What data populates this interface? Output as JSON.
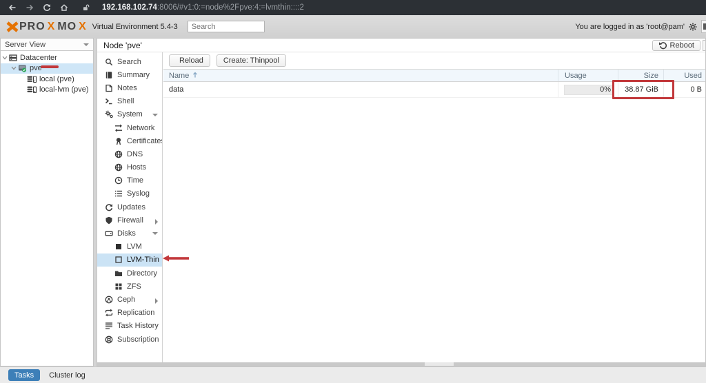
{
  "browser": {
    "url_host": "192.168.102.74",
    "url_path": ":8006/#v1:0:=node%2Fpve:4:=lvmthin::::2",
    "icons": [
      "back-icon",
      "forward-icon",
      "reload-icon",
      "home-icon",
      "lock-icon"
    ]
  },
  "header": {
    "brand": "PROXMOX",
    "brand_orange_letters": [
      3,
      6
    ],
    "subtitle": "Virtual Environment 5.4-3",
    "search_placeholder": "Search",
    "login_text": "You are logged in as 'root@pam'",
    "gear_icon": "gear-icon",
    "accent_orange": "#e57200"
  },
  "sidebar": {
    "view_label": "Server View",
    "tree": [
      {
        "label": "Datacenter",
        "icon": "datacenter-icon",
        "depth": 0,
        "expanded": true,
        "selected": false
      },
      {
        "label": "pve",
        "icon": "node-icon",
        "depth": 1,
        "expanded": true,
        "selected": true
      },
      {
        "label": "local (pve)",
        "icon": "storage-icon",
        "depth": 2,
        "expanded": null,
        "selected": false
      },
      {
        "label": "local-lvm (pve)",
        "icon": "storage-icon",
        "depth": 2,
        "expanded": null,
        "selected": false
      }
    ]
  },
  "node_panel": {
    "title": "Node 'pve'",
    "reboot_label": "Reboot",
    "reboot_icon": "reboot-icon",
    "menu": [
      {
        "label": "Search",
        "icon": "search-icon",
        "child": false,
        "state": null,
        "selected": false
      },
      {
        "label": "Summary",
        "icon": "book-icon",
        "child": false,
        "state": null,
        "selected": false
      },
      {
        "label": "Notes",
        "icon": "note-icon",
        "child": false,
        "state": null,
        "selected": false
      },
      {
        "label": "Shell",
        "icon": "terminal-icon",
        "child": false,
        "state": null,
        "selected": false
      },
      {
        "label": "System",
        "icon": "cogs-icon",
        "child": false,
        "state": "expanded",
        "selected": false
      },
      {
        "label": "Network",
        "icon": "network-icon",
        "child": true,
        "state": null,
        "selected": false
      },
      {
        "label": "Certificates",
        "icon": "certificate-icon",
        "child": true,
        "state": null,
        "selected": false
      },
      {
        "label": "DNS",
        "icon": "globe-icon",
        "child": true,
        "state": null,
        "selected": false
      },
      {
        "label": "Hosts",
        "icon": "globe-icon",
        "child": true,
        "state": null,
        "selected": false
      },
      {
        "label": "Time",
        "icon": "clock-icon",
        "child": true,
        "state": null,
        "selected": false
      },
      {
        "label": "Syslog",
        "icon": "list-icon",
        "child": true,
        "state": null,
        "selected": false
      },
      {
        "label": "Updates",
        "icon": "refresh-icon",
        "child": false,
        "state": null,
        "selected": false
      },
      {
        "label": "Firewall",
        "icon": "shield-icon",
        "child": false,
        "state": "collapsed",
        "selected": false
      },
      {
        "label": "Disks",
        "icon": "disk-icon",
        "child": false,
        "state": "expanded",
        "selected": false
      },
      {
        "label": "LVM",
        "icon": "square-filled-icon",
        "child": true,
        "state": null,
        "selected": false
      },
      {
        "label": "LVM-Thin",
        "icon": "square-outline-icon",
        "child": true,
        "state": null,
        "selected": true
      },
      {
        "label": "Directory",
        "icon": "folder-icon",
        "child": true,
        "state": null,
        "selected": false
      },
      {
        "label": "ZFS",
        "icon": "grid-icon",
        "child": true,
        "state": null,
        "selected": false
      },
      {
        "label": "Ceph",
        "icon": "ceph-icon",
        "child": false,
        "state": "collapsed",
        "selected": false
      },
      {
        "label": "Replication",
        "icon": "replication-icon",
        "child": false,
        "state": null,
        "selected": false
      },
      {
        "label": "Task History",
        "icon": "history-icon",
        "child": false,
        "state": null,
        "selected": false
      },
      {
        "label": "Subscription",
        "icon": "subscription-icon",
        "child": false,
        "state": null,
        "selected": false
      }
    ]
  },
  "content": {
    "toolbar": {
      "reload_label": "Reload",
      "reload_icon": "reload-dark-icon",
      "create_label": "Create: Thinpool"
    },
    "table": {
      "columns": [
        "Name",
        "Usage",
        "Size",
        "Used"
      ],
      "sort_column": "Name",
      "sort_dir": "asc",
      "rows": [
        {
          "name": "data",
          "usage": "0%",
          "size": "38.87 GiB",
          "used": "0 B"
        }
      ]
    }
  },
  "status_bar": {
    "tasks_label": "Tasks",
    "cluster_log_label": "Cluster log",
    "tasks_color": "#3d7fb8"
  },
  "annotations": {
    "color": "#c2383b",
    "items": [
      "red-underline-on-pve",
      "red-arrow-at-lvm-thin",
      "red-box-around-size-value"
    ]
  }
}
